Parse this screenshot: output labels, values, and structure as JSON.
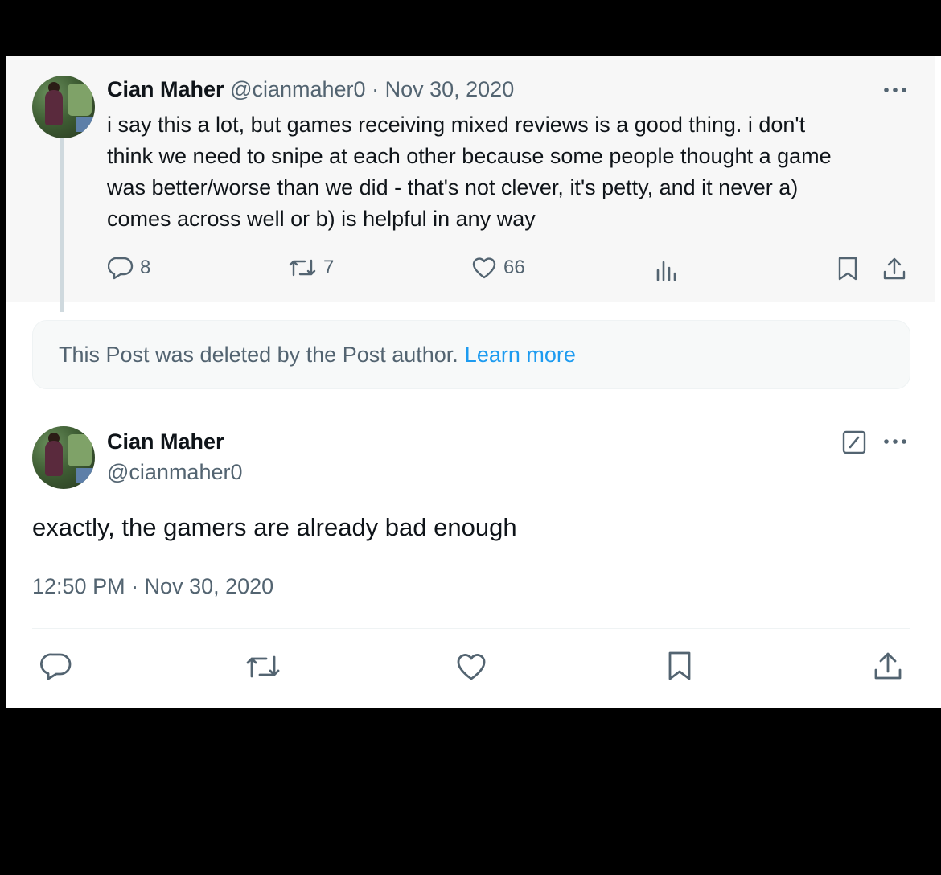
{
  "parent_post": {
    "author_name": "Cian Maher",
    "author_handle": "@cianmaher0",
    "separator": "·",
    "date": "Nov 30, 2020",
    "text_lines": [
      "i say this a lot, but games receiving mixed reviews is a good thing. i don't",
      "think we need to snipe at each other because some people thought a game",
      "was better/worse than we did - that's not clever, it's petty, and it never a)",
      "comes across well or b) is helpful in any way"
    ],
    "reply_count": "8",
    "repost_count": "7",
    "like_count": "66"
  },
  "deleted_notice": {
    "text": "This Post was deleted by the Post author.",
    "link": "Learn more"
  },
  "main_post": {
    "author_name": "Cian Maher",
    "author_handle": "@cianmaher0",
    "text": "exactly, the gamers are already bad enough",
    "timestamp": "12:50 PM · Nov 30, 2020"
  },
  "icons": {
    "more": "more-icon",
    "reply": "reply-icon",
    "repost": "repost-icon",
    "like": "like-icon",
    "views": "views-icon",
    "bookmark": "bookmark-icon",
    "share": "share-icon",
    "edit": "edit-icon"
  },
  "colors": {
    "link": "#1d9bf0",
    "muted": "#536471",
    "text": "#0f1419"
  }
}
